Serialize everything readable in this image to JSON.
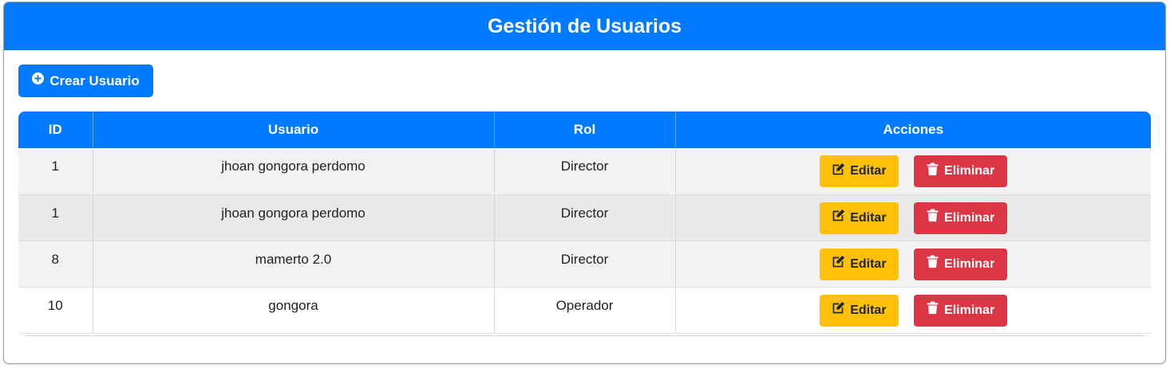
{
  "header": {
    "title": "Gestión de Usuarios"
  },
  "toolbar": {
    "create_label": "Crear Usuario",
    "create_icon": "plus-circle-icon"
  },
  "table": {
    "columns": [
      "ID",
      "Usuario",
      "Rol",
      "Acciones"
    ],
    "rows": [
      {
        "id": "1",
        "usuario": "jhoan gongora perdomo",
        "rol": "Director"
      },
      {
        "id": "1",
        "usuario": "jhoan gongora perdomo",
        "rol": "Director"
      },
      {
        "id": "8",
        "usuario": "mamerto 2.0",
        "rol": "Director"
      },
      {
        "id": "10",
        "usuario": "gongora",
        "rol": "Operador"
      }
    ],
    "edit_label": "Editar",
    "edit_icon": "edit-icon",
    "delete_label": "Eliminar",
    "delete_icon": "trash-icon"
  },
  "colors": {
    "primary": "#007bff",
    "warning": "#ffc107",
    "danger": "#dc3545"
  }
}
